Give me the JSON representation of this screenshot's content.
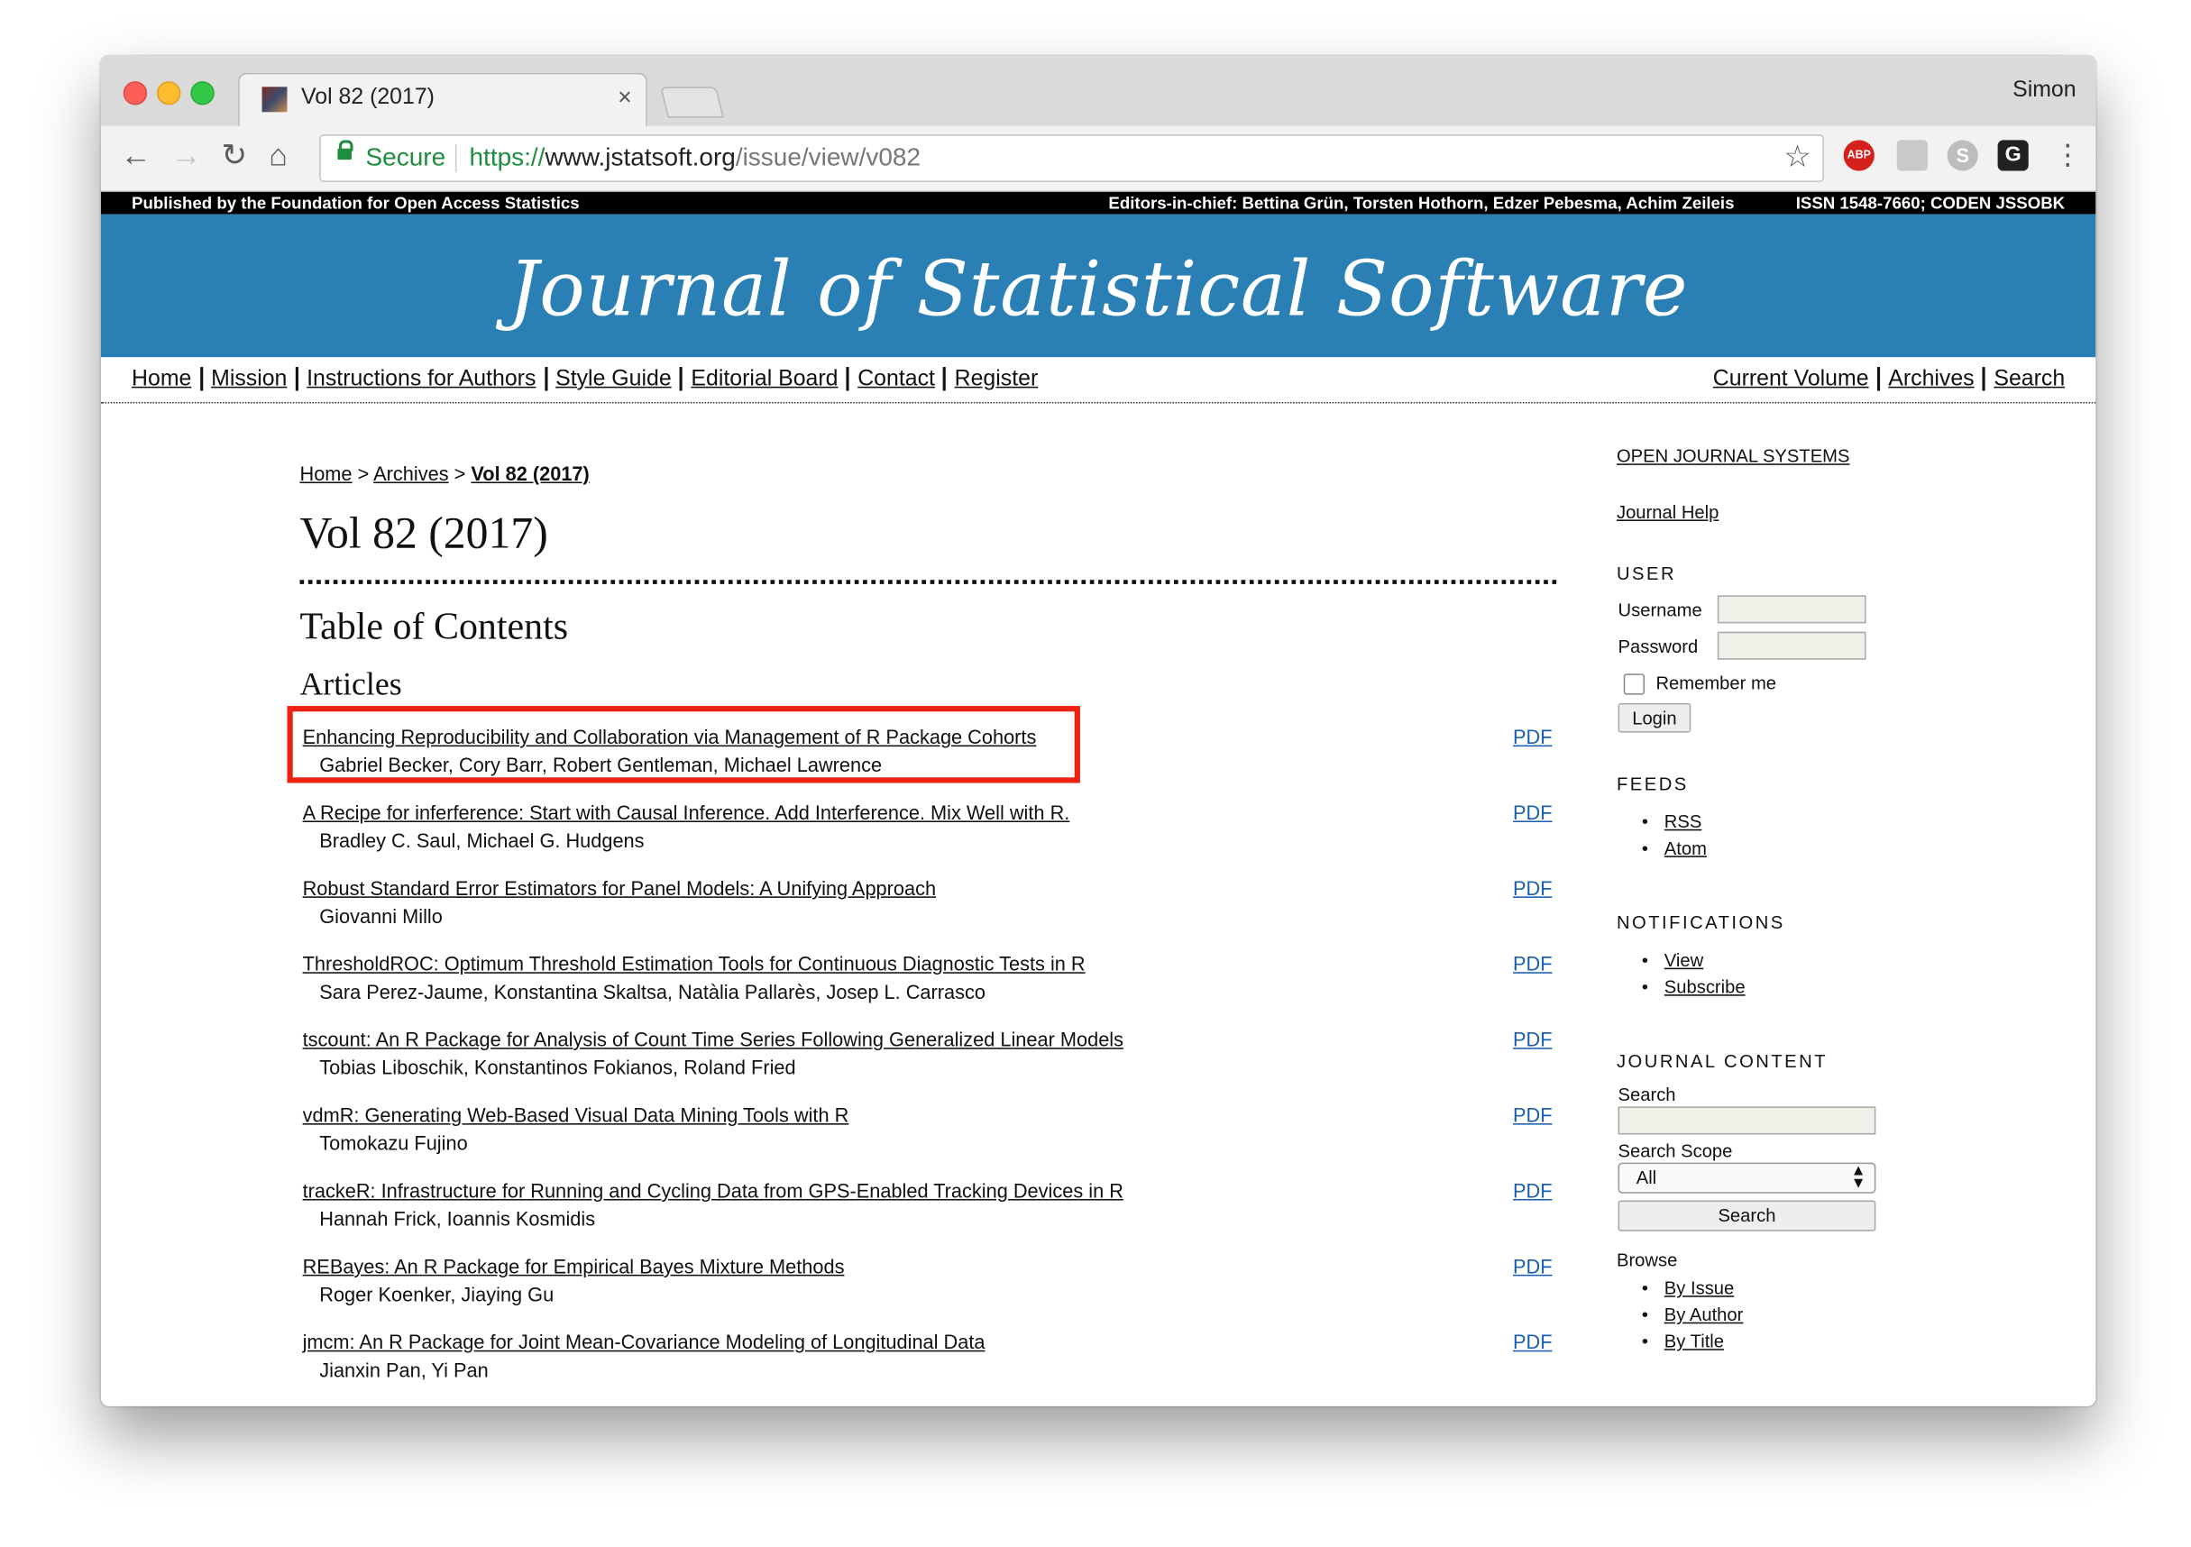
{
  "browser": {
    "tab_title": "Vol 82 (2017)",
    "tab_close": "×",
    "profile_name": "Simon",
    "secure_label": "Secure",
    "url_scheme": "https://",
    "url_host": "www.jstatsoft.org",
    "url_path": "/issue/view/v082",
    "back_glyph": "←",
    "forward_glyph": "→",
    "reload_glyph": "↻",
    "home_glyph": "⌂",
    "star_glyph": "☆",
    "menu_glyph": "⋮",
    "ext_abp": "ABP",
    "ext_s": "S",
    "ext_g": "G"
  },
  "site": {
    "publisher": "Published by the Foundation for Open Access Statistics",
    "editors": "Editors-in-chief: Bettina Grün, Torsten Hothorn, Edzer Pebesma, Achim Zeileis",
    "issn": "ISSN 1548-7660; CODEN JSSOBK",
    "journal_title": "Journal of Statistical Software",
    "banner_color": "#2a7fb5",
    "nav_left": [
      "Home",
      "Mission",
      "Instructions for Authors",
      "Style Guide",
      "Editorial Board",
      "Contact",
      "Register"
    ],
    "nav_right": [
      "Current Volume",
      "Archives",
      "Search"
    ]
  },
  "breadcrumb": {
    "home": "Home",
    "sep1": ">",
    "archives": "Archives",
    "sep2": ">",
    "current": "Vol 82 (2017)"
  },
  "main": {
    "page_title": "Vol 82 (2017)",
    "toc_heading": "Table of Contents",
    "section_heading": "Articles",
    "highlight_color": "#ec2312",
    "articles": [
      {
        "title": "Enhancing Reproducibility and Collaboration via Management of R Package Cohorts",
        "authors": "Gabriel Becker, Cory Barr, Robert Gentleman, Michael Lawrence",
        "pdf": "PDF"
      },
      {
        "title": "A Recipe for inferference: Start with Causal Inference. Add Interference. Mix Well with R.",
        "authors": "Bradley C. Saul, Michael G. Hudgens",
        "pdf": "PDF"
      },
      {
        "title": "Robust Standard Error Estimators for Panel Models: A Unifying Approach",
        "authors": "Giovanni Millo",
        "pdf": "PDF"
      },
      {
        "title": "ThresholdROC: Optimum Threshold Estimation Tools for Continuous Diagnostic Tests in R",
        "authors": "Sara Perez-Jaume, Konstantina Skaltsa, Natàlia Pallarès, Josep L. Carrasco",
        "pdf": "PDF"
      },
      {
        "title": "tscount: An R Package for Analysis of Count Time Series Following Generalized Linear Models",
        "authors": "Tobias Liboschik, Konstantinos Fokianos, Roland Fried",
        "pdf": "PDF"
      },
      {
        "title": "vdmR: Generating Web-Based Visual Data Mining Tools with R",
        "authors": "Tomokazu Fujino",
        "pdf": "PDF"
      },
      {
        "title": "trackeR: Infrastructure for Running and Cycling Data from GPS-Enabled Tracking Devices in R",
        "authors": "Hannah Frick, Ioannis Kosmidis",
        "pdf": "PDF"
      },
      {
        "title": "REBayes: An R Package for Empirical Bayes Mixture Methods",
        "authors": "Roger Koenker, Jiaying Gu",
        "pdf": "PDF"
      },
      {
        "title": "jmcm: An R Package for Joint Mean-Covariance Modeling of Longitudinal Data",
        "authors": "Jianxin Pan, Yi Pan",
        "pdf": "PDF"
      }
    ]
  },
  "sidebar": {
    "ojs_link": "OPEN JOURNAL SYSTEMS",
    "help_link": "Journal Help",
    "user_title": "USER",
    "username_label": "Username",
    "password_label": "Password",
    "remember_label": "Remember me",
    "login_button": "Login",
    "feeds_title": "FEEDS",
    "feeds": [
      "RSS",
      "Atom"
    ],
    "notifications_title": "NOTIFICATIONS",
    "notifications": [
      "View",
      "Subscribe"
    ],
    "content_title": "JOURNAL CONTENT",
    "search_label": "Search",
    "scope_label": "Search Scope",
    "scope_value": "All",
    "search_button": "Search",
    "browse_label": "Browse",
    "browse": [
      "By Issue",
      "By Author",
      "By Title"
    ]
  }
}
